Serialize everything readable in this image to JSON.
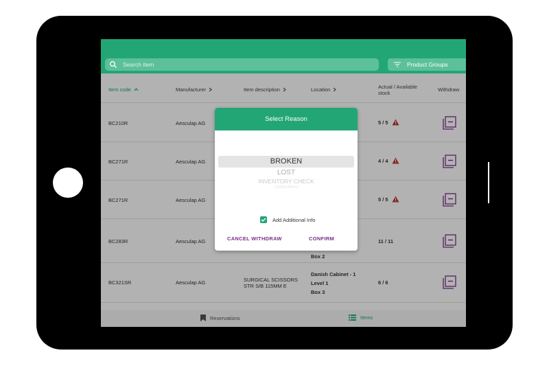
{
  "search": {
    "placeholder": "Search item"
  },
  "filter": {
    "label": "Product Groups"
  },
  "table": {
    "headers": {
      "item_code": "Item code",
      "manufacturer": "Manufacturer",
      "description": "Item description",
      "location": "Location",
      "stock": "Actual / Available stock",
      "withdraw": "Withdraw"
    },
    "rows": [
      {
        "code": "BC210R",
        "manufacturer": "Aesculap AG",
        "description": "",
        "location": [],
        "stock": "5 / 5",
        "warning": true
      },
      {
        "code": "BC271R",
        "manufacturer": "Aesculap AG",
        "description": "",
        "location": [],
        "stock": "4 / 4",
        "warning": true
      },
      {
        "code": "BC271R",
        "manufacturer": "Aesculap AG",
        "description": "",
        "location": [],
        "stock": "5 / 5",
        "warning": true
      },
      {
        "code": "BC283R",
        "manufacturer": "Aesculap AG",
        "description": "",
        "location": [
          "Box 2"
        ],
        "stock": "11 / 11",
        "warning": false
      },
      {
        "code": "BC321SR",
        "manufacturer": "Aesculap AG",
        "description": "SURGICAL SCISSORS STR S/B 115MM E",
        "location": [
          "Danish Cabinet - 1",
          "Level 1",
          "Box 3"
        ],
        "stock": "6 / 6",
        "warning": false
      }
    ]
  },
  "tabs": {
    "reservations": "Reservations",
    "items": "Items"
  },
  "modal": {
    "title": "Select Reason",
    "selected": "BROKEN",
    "options": [
      "LOST",
      "INVENTORY CHECK",
      "CONSUMED"
    ],
    "checkbox_label": "Add Additional Info",
    "checkbox_checked": true,
    "cancel": "CANCEL WITHDRAW",
    "confirm": "CONFIRM"
  },
  "colors": {
    "brand": "#23a675",
    "accent": "#7a2d8a",
    "warning": "#c0392b"
  }
}
